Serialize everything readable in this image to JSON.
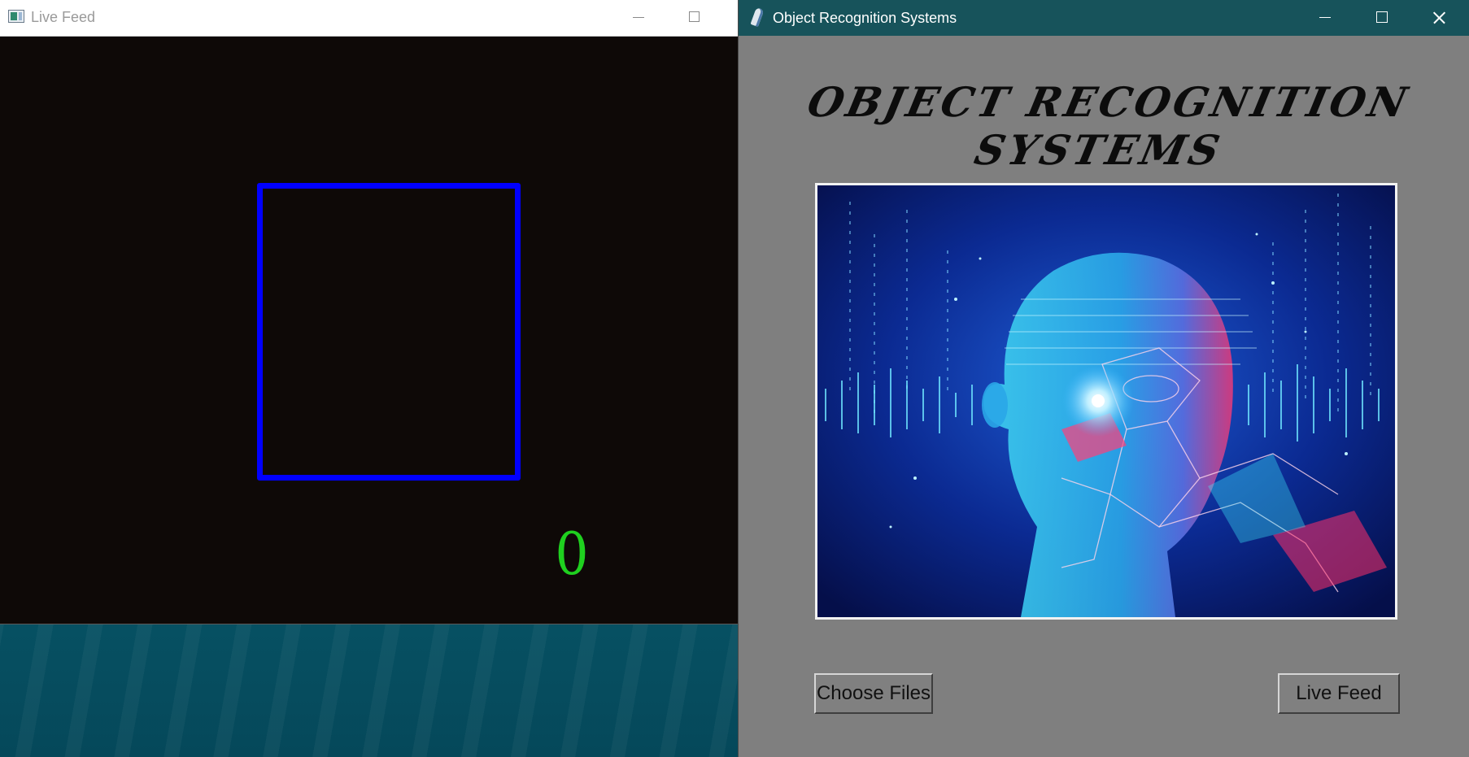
{
  "live_feed": {
    "title": "Live Feed",
    "detection_label": "0",
    "detection_box_color": "#0000ff",
    "detection_label_color": "#1fd01f"
  },
  "recognition": {
    "title": "Object Recognition Systems",
    "heading": "OBJECT RECOGNITION SYSTEMS",
    "choose_files_label": "Choose Files",
    "live_feed_label": "Live Feed",
    "titlebar_color": "#17535b",
    "background_color": "#7f7f7f"
  },
  "icons": {
    "live_feed_app": "python-window-icon",
    "recognition_app": "tk-feather-icon",
    "minimize": "minimize-icon",
    "maximize": "maximize-icon",
    "close": "close-icon"
  }
}
